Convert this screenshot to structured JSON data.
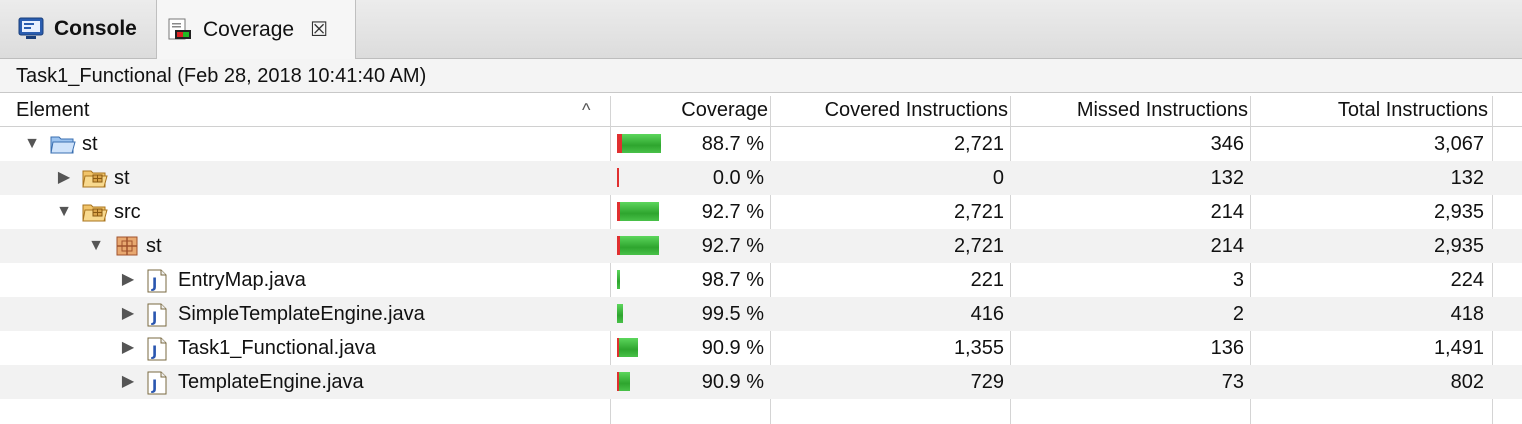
{
  "tabs": [
    {
      "label": "Console",
      "icon": "console-icon"
    },
    {
      "label": "Coverage",
      "icon": "coverage-icon",
      "close": "☒"
    }
  ],
  "session_title": "Task1_Functional (Feb 28, 2018 10:41:40 AM)",
  "columns": {
    "element": "Element",
    "coverage": "Coverage",
    "covered": "Covered Instructions",
    "missed": "Missed Instructions",
    "total": "Total Instructions"
  },
  "rows": [
    {
      "name": "st",
      "icon": "open-project-folder-icon",
      "expanded": true,
      "depth": 0,
      "coverage": "88.7 %",
      "covered": "2,721",
      "missed": "346",
      "total": "3,067",
      "ratio": 0.887
    },
    {
      "name": "st",
      "icon": "package-folder-icon",
      "expanded": false,
      "depth": 1,
      "coverage": "0.0 %",
      "covered": "0",
      "missed": "132",
      "total": "132",
      "ratio": 0.0
    },
    {
      "name": "src",
      "icon": "package-folder-icon",
      "expanded": true,
      "depth": 1,
      "coverage": "92.7 %",
      "covered": "2,721",
      "missed": "214",
      "total": "2,935",
      "ratio": 0.927
    },
    {
      "name": "st",
      "icon": "package-icon",
      "expanded": true,
      "depth": 2,
      "coverage": "92.7 %",
      "covered": "2,721",
      "missed": "214",
      "total": "2,935",
      "ratio": 0.927
    },
    {
      "name": "EntryMap.java",
      "icon": "java-file-icon",
      "expanded": false,
      "depth": 3,
      "coverage": "98.7 %",
      "covered": "221",
      "missed": "3",
      "total": "224",
      "ratio": 0.987
    },
    {
      "name": "SimpleTemplateEngine.java",
      "icon": "java-file-icon",
      "expanded": false,
      "depth": 3,
      "coverage": "99.5 %",
      "covered": "416",
      "missed": "2",
      "total": "418",
      "ratio": 0.995
    },
    {
      "name": "Task1_Functional.java",
      "icon": "java-file-icon",
      "expanded": false,
      "depth": 3,
      "coverage": "90.9 %",
      "covered": "1,355",
      "missed": "136",
      "total": "1,491",
      "ratio": 0.909
    },
    {
      "name": "TemplateEngine.java",
      "icon": "java-file-icon",
      "expanded": false,
      "depth": 3,
      "coverage": "90.9 %",
      "covered": "729",
      "missed": "73",
      "total": "802",
      "ratio": 0.909
    }
  ],
  "colors": {
    "covered": "#2ea52e",
    "missed": "#e03030"
  }
}
